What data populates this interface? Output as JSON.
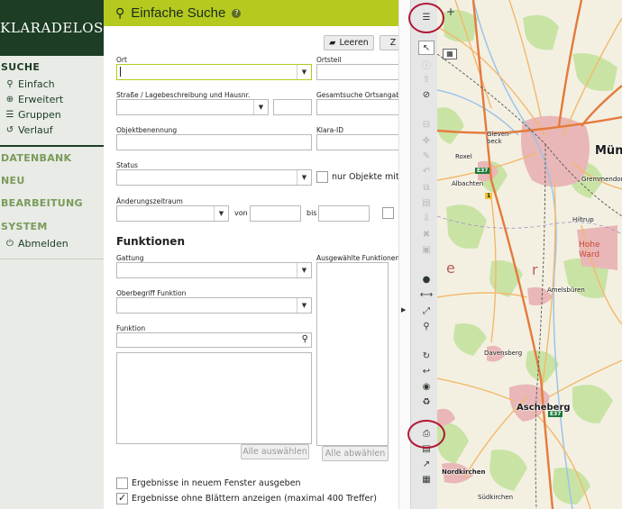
{
  "app": {
    "logo": "KLARADELOS"
  },
  "nav": {
    "suche": "SUCHE",
    "items": [
      {
        "label": "Einfach",
        "icon": "search-icon"
      },
      {
        "label": "Erweitert",
        "icon": "search-plus-icon"
      },
      {
        "label": "Gruppen",
        "icon": "list-icon"
      },
      {
        "label": "Verlauf",
        "icon": "history-icon"
      }
    ],
    "datenbank": "DATENBANK",
    "neu": "NEU",
    "bearbeitung": "BEARBEITUNG",
    "system": "SYSTEM",
    "abmelden": "Abmelden"
  },
  "header": {
    "title": "Einfache Suche",
    "help": "?"
  },
  "form": {
    "leeren": "Leeren",
    "z": "Z",
    "ort": "Ort",
    "ortsteil": "Ortsteil",
    "strasse": "Straße / Lagebeschreibung und Hausnr.",
    "gesamtsuche": "Gesamtsuche Ortsangab",
    "objektbenennung": "Objektbenennung",
    "klara_id": "Klara-ID",
    "status": "Status",
    "nur_objekte": "nur Objekte mit",
    "aenderungszeitraum": "Änderungszeitraum",
    "von": "von",
    "bis": "bis",
    "funktionen": "Funktionen",
    "gattung": "Gattung",
    "ausgewaehlte": "Ausgewählte Funktionen",
    "oberbegriff": "Oberbegriff Funktion",
    "funktion": "Funktion",
    "alle_auswaehlen": "Alle auswählen",
    "alle_abwaehlen": "Alle abwählen",
    "neues_fenster": "Ergebnisse in neuem Fenster ausgeben",
    "ohne_blaettern": "Ergebnisse ohne Blättern anzeigen (maximal 400 Treffer)",
    "neues_fenster_checked": false,
    "ohne_blaettern_checked": true
  },
  "map": {
    "labels": {
      "muen": "Mün",
      "ascheberg": "Ascheberg",
      "nordkirchen": "Nordkirchen",
      "suedkirchen": "Südkirchen",
      "hohe_ward": "Hohe Ward",
      "davensberg": "Davensberg",
      "albachten": "Albachten",
      "amelsbueren": "Amelsbüren",
      "gievenbeck": "Gieven-beck",
      "roxel": "Roxel",
      "hiltrup": "Hiltrup",
      "gremmendorf": "Gremmendorf",
      "e37": "E37",
      "a1": "1"
    },
    "colors": {
      "autobahn": "#e57a3c",
      "road": "#f3b86a",
      "forest": "#c9e3a5",
      "urban": "#e9b7b7",
      "water": "#9cc3e8"
    }
  }
}
